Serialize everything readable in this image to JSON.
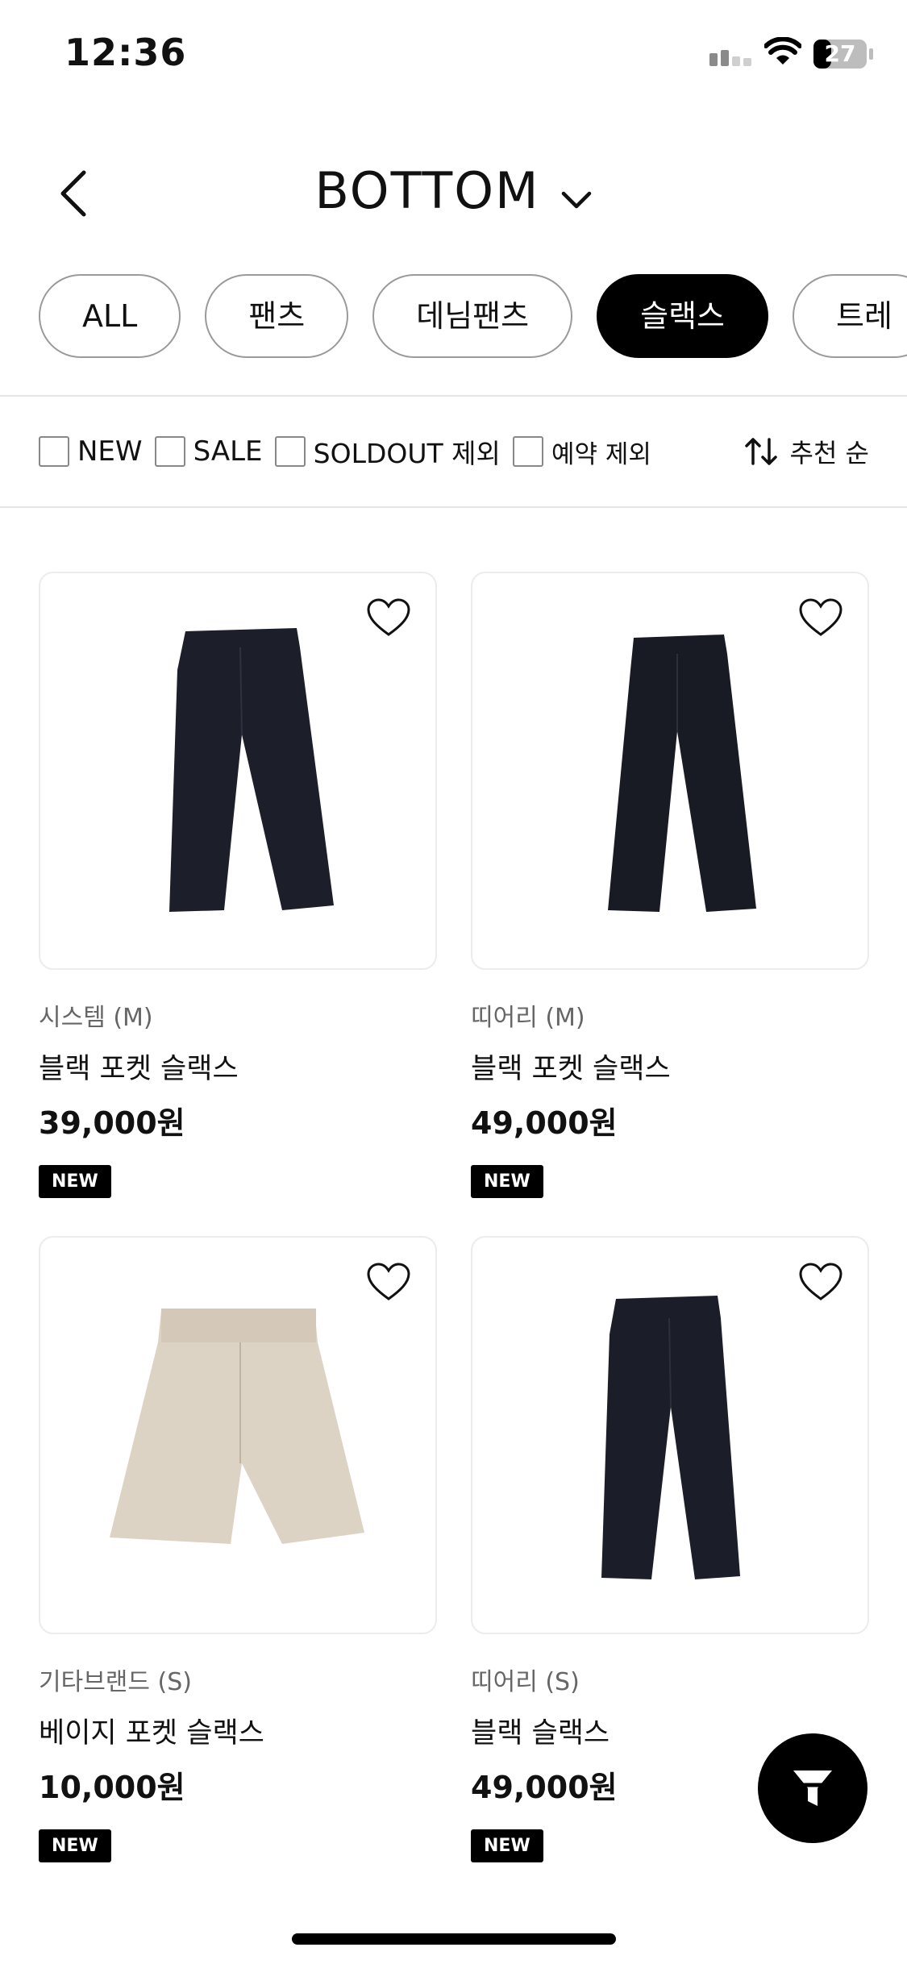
{
  "status": {
    "time": "12:36",
    "battery": "27"
  },
  "header": {
    "title": "BOTTOM"
  },
  "chips": [
    "ALL",
    "팬츠",
    "데님팬츠",
    "슬랙스",
    "트레"
  ],
  "filters": [
    {
      "label": "NEW"
    },
    {
      "label": "SALE"
    },
    {
      "label": "SOLDOUT 제외"
    },
    {
      "label": "예약 제외"
    }
  ],
  "sort": {
    "label": "추천 순"
  },
  "products": [
    {
      "brand": "시스템 (M)",
      "name": "블랙 포켓 슬랙스",
      "price": "39,000원",
      "badge": "NEW"
    },
    {
      "brand": "띠어리 (M)",
      "name": "블랙 포켓 슬랙스",
      "price": "49,000원",
      "badge": "NEW"
    },
    {
      "brand": "기타브랜드 (S)",
      "name": "베이지 포켓 슬랙스",
      "price": "10,000원",
      "badge": "NEW"
    },
    {
      "brand": "띠어리 (S)",
      "name": "블랙 슬랙스",
      "price": "49,000원",
      "badge": "NEW"
    }
  ],
  "colors": {
    "accent": "#000000",
    "garment_dark": "#1c1f2a",
    "garment_beige": "#ddd3c5"
  }
}
